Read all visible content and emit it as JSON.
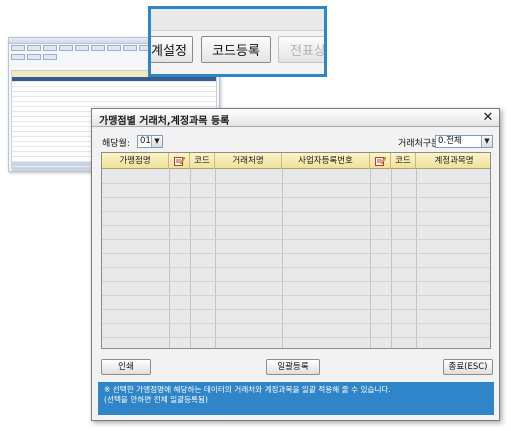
{
  "callout": {
    "buttons": [
      {
        "label": "계설정",
        "enabled": true
      },
      {
        "label": "코드등록",
        "enabled": true
      },
      {
        "label": "전표상",
        "enabled": false
      }
    ]
  },
  "dialog": {
    "title": "가맹점별 거래처,계정과목 등록",
    "close": "✕",
    "month_label": "해당월:",
    "month_value": "01",
    "vendor_type_label": "거래처구분",
    "vendor_type_value": "0.전체",
    "columns": [
      "가맹점명",
      "",
      "코드",
      "거래처명",
      "사업자등록번호",
      "",
      "코드",
      "계정과목명"
    ],
    "row_count": 13,
    "buttons": {
      "print": "인쇄",
      "bulk_register": "일괄등록",
      "exit": "종료(ESC)"
    },
    "info_lines": [
      "※ 선택한 가맹점명에 해당하는 데이터의 거래처와 계정과목을 일괄 적용해 줄 수 있습니다.",
      "(선택을 안하면 전체 일괄등록됨)"
    ]
  },
  "colors": {
    "callout_border": "#2d86c6",
    "info_bg": "#2f85c7",
    "header_bg": "#f4e6a6"
  }
}
